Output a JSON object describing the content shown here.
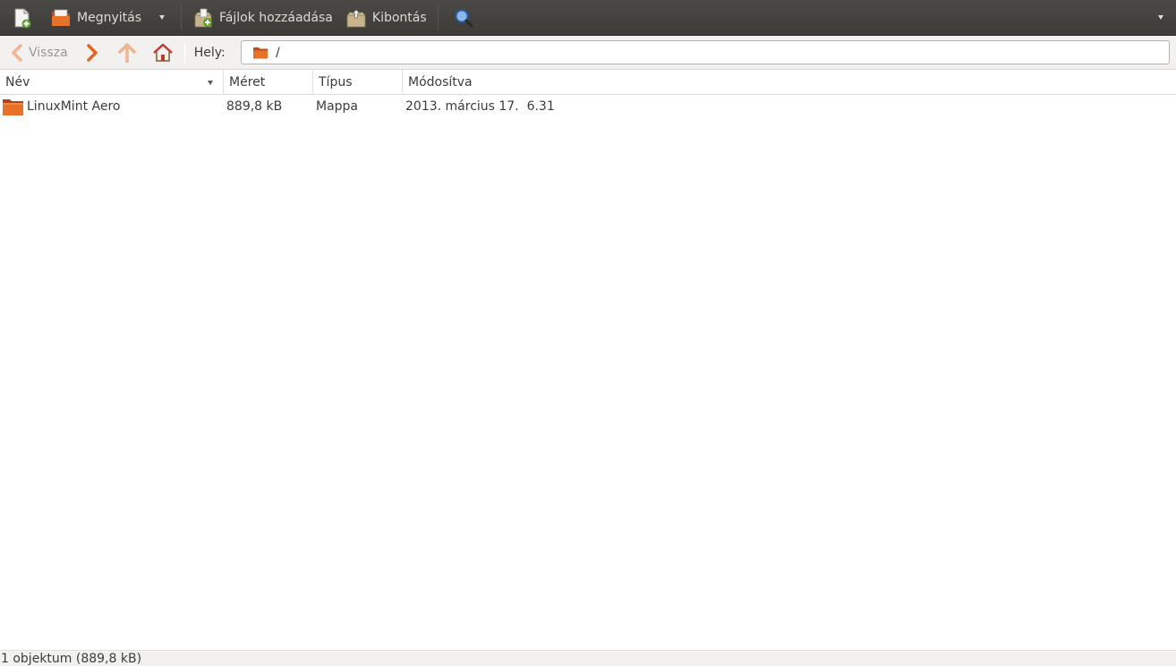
{
  "toolbar": {
    "new_label": "",
    "open_label": "Megnyitás",
    "add_files_label": "Fájlok hozzáadása",
    "extract_label": "Kibontás"
  },
  "location_bar": {
    "back_label": "Vissza",
    "location_label": "Hely:",
    "path": "/"
  },
  "columns": {
    "name": "Név",
    "size": "Méret",
    "type": "Típus",
    "modified": "Módosítva"
  },
  "files": [
    {
      "name": "LinuxMint Aero",
      "size": "889,8 kB",
      "type": "Mappa",
      "modified": "2013. március 17.  6.31",
      "icon": "folder-icon"
    }
  ],
  "status": {
    "text": "1 objektum (889,8 kB)"
  },
  "colors": {
    "toolbar_bg": "#3c3b37",
    "toolbar_text": "#dfdbd2",
    "accent_orange": "#e2661e",
    "background": "#ffffff",
    "chrome": "#f2f1f0"
  }
}
